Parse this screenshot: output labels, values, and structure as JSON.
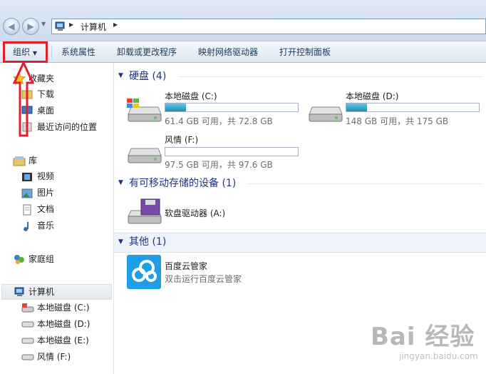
{
  "address": {
    "path_item": "计算机"
  },
  "toolbar": {
    "organize": "组织",
    "system_properties": "系统属性",
    "uninstall": "卸载或更改程序",
    "map_drive": "映射网络驱动器",
    "control_panel": "打开控制面板"
  },
  "nav": {
    "favorites": {
      "label": "收藏夹",
      "items": [
        "下载",
        "桌面",
        "最近访问的位置"
      ]
    },
    "libraries": {
      "label": "库",
      "items": [
        "视频",
        "图片",
        "文档",
        "音乐"
      ]
    },
    "homegroup": "家庭组",
    "computer": {
      "label": "计算机",
      "items": [
        "本地磁盘 (C:)",
        "本地磁盘 (D:)",
        "本地磁盘 (E:)",
        "风情 (F:)"
      ]
    }
  },
  "groups": {
    "hard_disks": "硬盘 (4)",
    "removable": "有可移动存储的设备 (1)",
    "other": "其他 (1)"
  },
  "drives": [
    {
      "name": "本地磁盘 (C:)",
      "free_text": "61.4 GB 可用，共 72.8 GB",
      "used_fraction": 0.157
    },
    {
      "name": "本地磁盘 (D:)",
      "free_text": "148 GB 可用，共 175 GB",
      "used_fraction": 0.154
    },
    {
      "name": "风情 (F:)",
      "free_text": "97.5 GB 可用，共 97.6 GB",
      "used_fraction": 0.001
    }
  ],
  "removable": [
    {
      "name": "软盘驱动器 (A:)"
    }
  ],
  "other": [
    {
      "name": "百度云管家",
      "desc": "双击运行百度云管家"
    }
  ],
  "watermark": {
    "logo": "Bai 经验",
    "url": "jingyan.baidu.com"
  },
  "colors": {
    "accent_red": "#e0202a",
    "bar_fill": "#26a0da",
    "group_heading": "#1e3287"
  }
}
